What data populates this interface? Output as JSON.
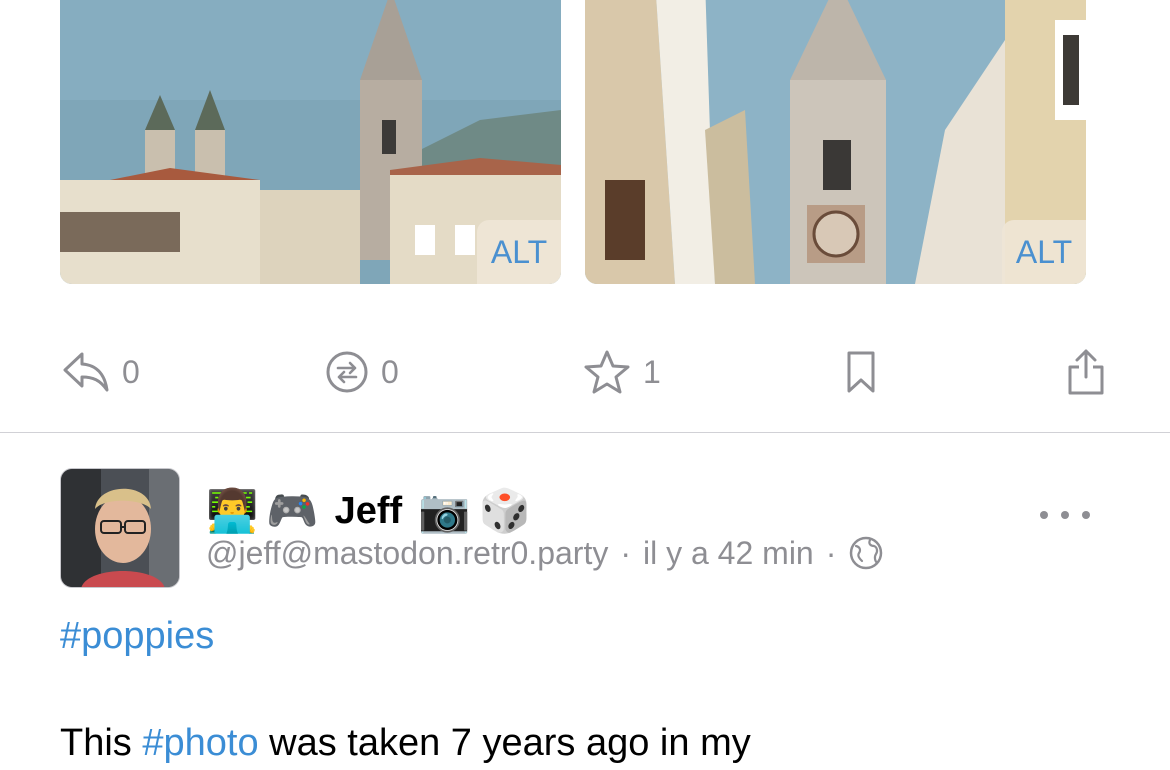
{
  "media": [
    {
      "alt_label": "ALT"
    },
    {
      "alt_label": "ALT"
    }
  ],
  "actions": {
    "reply_count": "0",
    "boost_count": "0",
    "favorite_count": "1"
  },
  "post": {
    "emojis_before": [
      "👨‍💻",
      "🎮"
    ],
    "display_name": "Jeff",
    "emojis_after": [
      "📷",
      "🎲"
    ],
    "handle": "@jeff@mastodon.retr0.party",
    "separator": "·",
    "time_ago": "il y a 42 min",
    "visibility_icon": "globe-icon",
    "hashtag": "#poppies",
    "body_start": "This",
    "body_tag": "#photo",
    "body_end": "was taken 7 years ago in my"
  },
  "colors": {
    "link": "#3b8dd5",
    "secondary_text": "#8e8e93",
    "divider": "#d1d1d6"
  }
}
